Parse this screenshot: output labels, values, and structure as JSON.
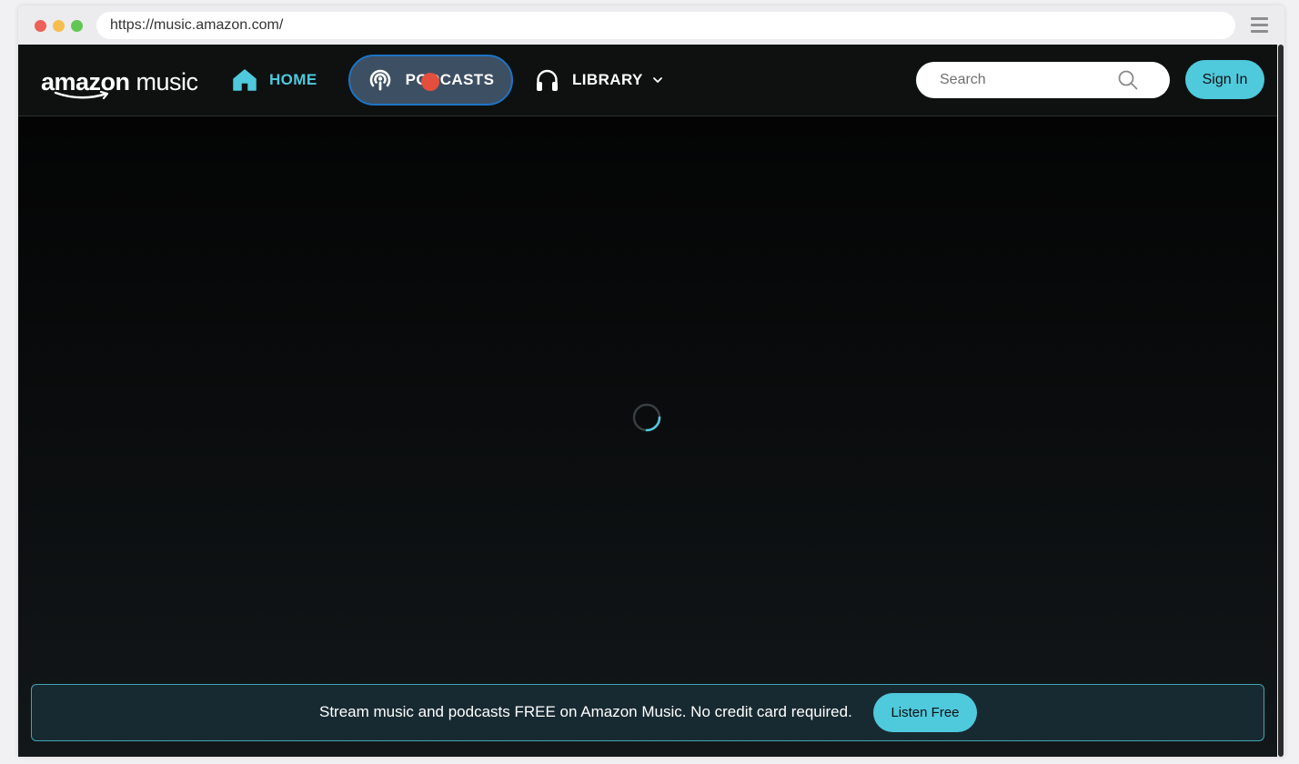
{
  "browser": {
    "url": "https://music.amazon.com/"
  },
  "header": {
    "logo_bold": "amazon",
    "logo_light": "music",
    "nav": {
      "home_label": "HOME",
      "podcasts_label": "PODCASTS",
      "library_label": "LIBRARY"
    },
    "search": {
      "placeholder": "Search"
    },
    "signin_label": "Sign In"
  },
  "main": {
    "loading": true
  },
  "banner": {
    "text": "Stream music and podcasts FREE on Amazon Music. No credit card required.",
    "button_label": "Listen Free"
  },
  "colors": {
    "accent": "#4fc9dc",
    "navbar_bg": "#0f1111",
    "podcasts_active_bg": "#3d4f63",
    "podcasts_active_border": "#1d74c5",
    "banner_bg": "#182a31",
    "banner_border": "#3fa5b3",
    "click_marker": "#e44e3c"
  },
  "icons": {
    "home": "home-icon",
    "podcasts": "podcast-icon",
    "library": "headphones-icon",
    "library_dropdown": "chevron-down-icon",
    "search": "search-icon",
    "loading": "spinner-icon"
  }
}
